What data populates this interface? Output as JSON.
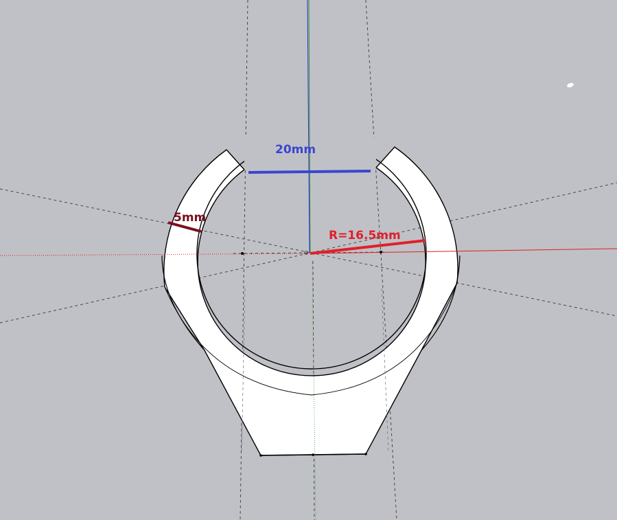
{
  "viewport": {
    "background_color": "#c0c1c6"
  },
  "model": {
    "face_color": "#ffffff",
    "edge_color": "#000000"
  },
  "axes": {
    "red_axis_color": "#d92020",
    "green_axis_color": "#2a9a2a",
    "blue_axis_color": "#2a2ad0"
  },
  "guides": {
    "guide_line_color": "#3a3a3a"
  },
  "dimensions": {
    "gap": {
      "label": "20mm",
      "color": "#3a45d0"
    },
    "thickness": {
      "label": "5mm",
      "color": "#7a0f1e"
    },
    "radius": {
      "label": "R=16.5mm",
      "color": "#e0202a"
    }
  }
}
